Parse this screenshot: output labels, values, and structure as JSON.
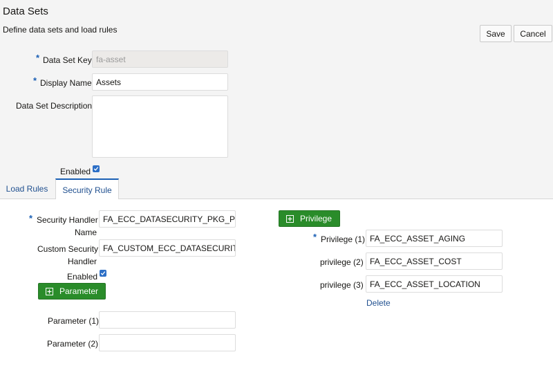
{
  "header": {
    "title": "Data Sets",
    "subtitle": "Define data sets and load rules",
    "save_label": "Save",
    "cancel_label": "Cancel"
  },
  "form": {
    "required_marker": "*",
    "data_set_key": {
      "label": "Data Set Key",
      "value": "fa-asset"
    },
    "display_name": {
      "label": "Display Name",
      "value": "Assets"
    },
    "description": {
      "label": "Data Set Description",
      "value": ""
    },
    "enabled": {
      "label": "Enabled",
      "checked": true
    }
  },
  "tabs": [
    {
      "label": "Load Rules",
      "active": false
    },
    {
      "label": "Security Rule",
      "active": true
    }
  ],
  "security_rule": {
    "handler_name": {
      "label_line1": "Security Handler",
      "label_line2": "Name",
      "value": "FA_ECC_DATASECURITY_PKG_PUB.Ge"
    },
    "custom_handler": {
      "label_line1": "Custom Security",
      "label_line2": "Handler",
      "value": "FA_CUSTOM_ECC_DATASECURITY_PK"
    },
    "enabled": {
      "label": "Enabled",
      "checked": true
    },
    "parameter_button": "Parameter",
    "parameters": [
      {
        "label": "Parameter (1)",
        "value": ""
      },
      {
        "label": "Parameter (2)",
        "value": ""
      }
    ],
    "privilege_button": "Privilege",
    "privileges": [
      {
        "label": "Privilege (1)",
        "value": "FA_ECC_ASSET_AGING",
        "required": true
      },
      {
        "label": "privilege (2)",
        "value": "FA_ECC_ASSET_COST",
        "required": false
      },
      {
        "label": "privilege (3)",
        "value": "FA_ECC_ASSET_LOCATION",
        "required": false
      }
    ],
    "delete_label": "Delete"
  },
  "colors": {
    "accent": "#1a5fb4",
    "link": "#1f4f8f",
    "green_button": "#2a8c2a"
  }
}
